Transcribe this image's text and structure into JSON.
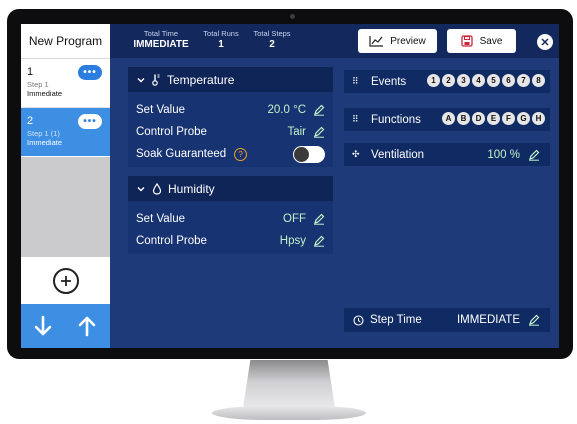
{
  "sidebar": {
    "title": "New Program",
    "steps": [
      {
        "number": "1",
        "subtitle": "Step 1",
        "start": "Immediate",
        "more": "•••"
      },
      {
        "number": "2",
        "subtitle": "Step 1 (1)",
        "start": "Immediate",
        "more": "•••"
      }
    ],
    "add_icon": "plus-circle-icon",
    "down_icon": "arrow-down-icon",
    "up_icon": "arrow-up-icon"
  },
  "header": {
    "total_time_label": "Total Time",
    "total_time_value": "IMMEDIATE",
    "total_runs_label": "Total Runs",
    "total_runs_value": "1",
    "total_steps_label": "Total Steps",
    "total_steps_value": "2",
    "preview_label": "Preview",
    "save_label": "Save",
    "close_icon": "close-icon"
  },
  "temperature": {
    "title": "Temperature",
    "set_value_label": "Set Value",
    "set_value": "20.0 °C",
    "control_probe_label": "Control Probe",
    "control_probe": "Tair",
    "soak_label": "Soak Guaranteed",
    "soak_help": "?",
    "soak_on": false
  },
  "humidity": {
    "title": "Humidity",
    "set_value_label": "Set Value",
    "set_value": "OFF",
    "control_probe_label": "Control Probe",
    "control_probe": "Hpsy"
  },
  "events": {
    "label": "Events",
    "items": [
      "1",
      "2",
      "3",
      "4",
      "5",
      "6",
      "7",
      "8"
    ]
  },
  "functions": {
    "label": "Functions",
    "items": [
      "A",
      "B",
      "D",
      "E",
      "F",
      "G",
      "H"
    ]
  },
  "ventilation": {
    "label": "Ventilation",
    "value": "100 %"
  },
  "step_time": {
    "label": "Step Time",
    "value": "IMMEDIATE"
  },
  "colors": {
    "screen_bg": "#1f3a78",
    "header_bg": "#13295e",
    "accent_blue": "#3d8fe3",
    "value_green": "#c3f3c9",
    "help_orange": "#f0a020"
  }
}
